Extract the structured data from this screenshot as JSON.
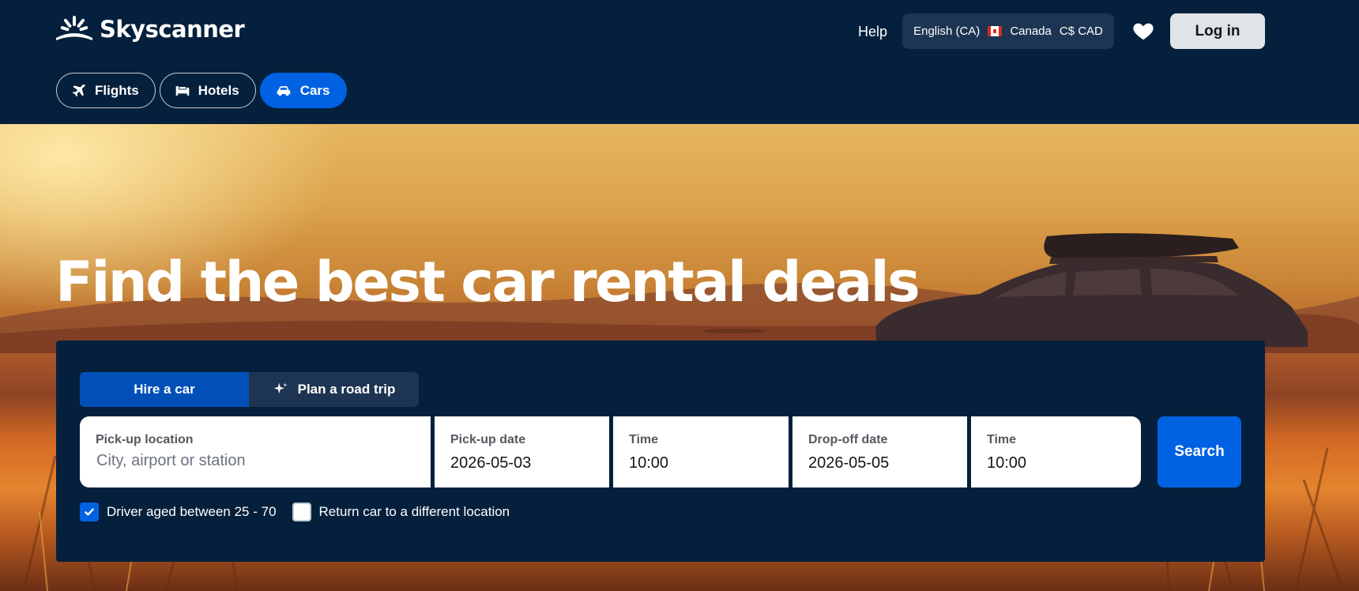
{
  "brand": {
    "name": "Skyscanner"
  },
  "header": {
    "help_label": "Help",
    "locale": {
      "language": "English (CA)",
      "country": "Canada",
      "currency": "C$ CAD"
    },
    "login_label": "Log in"
  },
  "nav": {
    "tabs": [
      {
        "label": "Flights",
        "icon": "plane-icon",
        "active": false
      },
      {
        "label": "Hotels",
        "icon": "bed-icon",
        "active": false
      },
      {
        "label": "Cars",
        "icon": "car-icon",
        "active": true
      }
    ]
  },
  "hero": {
    "headline": "Find the best car rental deals"
  },
  "search": {
    "modes": [
      {
        "label": "Hire a car",
        "active": true
      },
      {
        "label": "Plan a road trip",
        "icon": "sparkle-icon",
        "active": false
      }
    ],
    "pickup_location": {
      "label": "Pick-up location",
      "placeholder": "City, airport or station",
      "value": ""
    },
    "pickup_date": {
      "label": "Pick-up date",
      "value": "2026-05-03"
    },
    "pickup_time": {
      "label": "Time",
      "value": "10:00"
    },
    "dropoff_date": {
      "label": "Drop-off date",
      "value": "2026-05-05"
    },
    "dropoff_time": {
      "label": "Time",
      "value": "10:00"
    },
    "submit_label": "Search",
    "options": [
      {
        "label": "Driver aged between 25 - 70",
        "checked": true
      },
      {
        "label": "Return car to a different location",
        "checked": false
      }
    ]
  },
  "colors": {
    "navy": "#05203c",
    "blue": "#0062e3",
    "panel_tab": "#1d3553"
  }
}
